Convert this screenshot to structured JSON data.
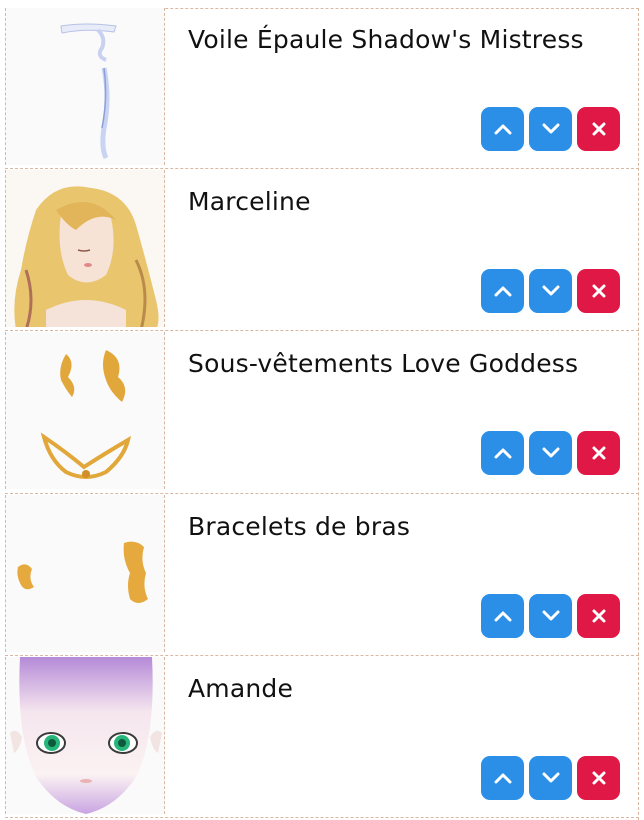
{
  "colors": {
    "move_button": "#2b8fe8",
    "remove_button": "#e01845",
    "divider": "#d9b8a3"
  },
  "items": [
    {
      "name": "Voile Épaule Shadow's Mistress",
      "thumbnail": "shoulder-veil"
    },
    {
      "name": "Marceline",
      "thumbnail": "blonde-hair"
    },
    {
      "name": "Sous-vêtements Love Goddess",
      "thumbnail": "gold-underwear"
    },
    {
      "name": "Bracelets de bras",
      "thumbnail": "gold-bracelets"
    },
    {
      "name": "Amande",
      "thumbnail": "green-eyes-face"
    }
  ],
  "buttons": {
    "up_icon": "chevron-up-icon",
    "down_icon": "chevron-down-icon",
    "remove_icon": "close-icon"
  }
}
